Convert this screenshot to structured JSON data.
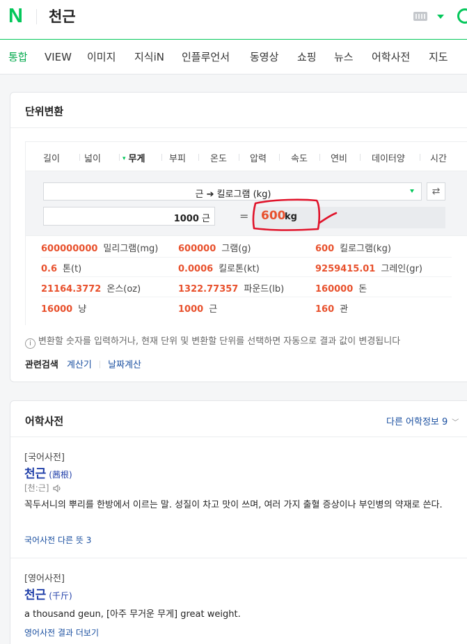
{
  "header": {
    "logo": "N",
    "query": "천근"
  },
  "tabs": [
    "통합",
    "VIEW",
    "이미지",
    "지식iN",
    "인플루언서",
    "동영상",
    "쇼핑",
    "뉴스",
    "어학사전",
    "지도"
  ],
  "converter": {
    "title": "단위변환",
    "unit_tabs": [
      "길이",
      "넓이",
      "무게",
      "부피",
      "온도",
      "압력",
      "속도",
      "연비",
      "데이터양",
      "시간"
    ],
    "active_tab": "무게",
    "select": "근 ➔ 킬로그램 (kg)",
    "input_value": "1000",
    "input_unit": "근",
    "equals": "=",
    "result_value": "600",
    "result_unit": "kg",
    "rows": [
      [
        {
          "v": "600000000",
          "u": "밀리그램(mg)"
        },
        {
          "v": "600000",
          "u": "그램(g)"
        },
        {
          "v": "600",
          "u": "킬로그램(kg)"
        }
      ],
      [
        {
          "v": "0.6",
          "u": "톤(t)"
        },
        {
          "v": "0.0006",
          "u": "킬로톤(kt)"
        },
        {
          "v": "9259415.01",
          "u": "그레인(gr)"
        }
      ],
      [
        {
          "v": "21164.3772",
          "u": "온스(oz)"
        },
        {
          "v": "1322.77357",
          "u": "파운드(lb)"
        },
        {
          "v": "160000",
          "u": "돈"
        }
      ],
      [
        {
          "v": "16000",
          "u": "냥"
        },
        {
          "v": "1000",
          "u": "근"
        },
        {
          "v": "160",
          "u": "관"
        }
      ]
    ],
    "notice": "변환할 숫자를 입력하거나, 현재 단위 및 변환할 단위를 선택하면 자동으로 결과 값이 변경됩니다",
    "related_label": "관련검색",
    "related_links": [
      "계산기",
      "날짜계산"
    ]
  },
  "dictionary": {
    "title": "어학사전",
    "more": "다른 어학정보 9",
    "entries": [
      {
        "category": "[국어사전]",
        "word": "천근",
        "hanja": "(茜根)",
        "pron": "[천:근]",
        "definition": "꼭두서니의 뿌리를 한방에서 이르는 말. 성질이 차고 맛이 쓰며, 여러 가지 출혈 증상이나 부인병의 약재로 쓴다.",
        "link": "국어사전 다른 뜻 3"
      },
      {
        "category": "[영어사전]",
        "word": "천근",
        "hanja": "(千斤)",
        "definition": "a thousand geun, [아주 무거운 무게] great weight.",
        "link": "영어사전 결과 더보기"
      }
    ]
  },
  "colors": {
    "brand": "#03c75a",
    "accent_red": "#e8512d",
    "link": "#1a4fa0",
    "annotation": "#e0132a"
  }
}
